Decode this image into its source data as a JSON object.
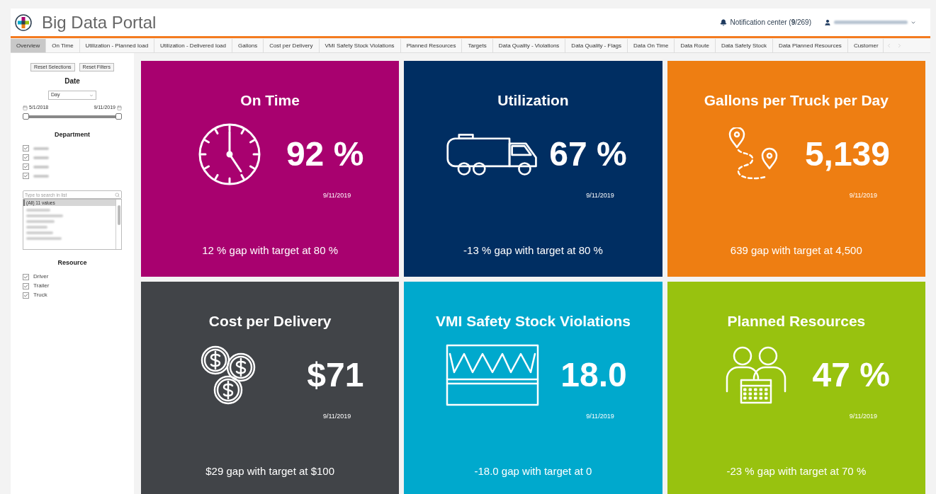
{
  "header": {
    "title": "Big Data Portal",
    "notification": "Notification center (**9**/269)"
  },
  "tabs": [
    {
      "label": "Overview",
      "selected": true
    },
    {
      "label": "On Time",
      "selected": false
    },
    {
      "label": "Utilization - Planned load",
      "selected": false
    },
    {
      "label": "Utilization - Delivered load",
      "selected": false
    },
    {
      "label": "Gallons",
      "selected": false
    },
    {
      "label": "Cost per Delivery",
      "selected": false
    },
    {
      "label": "VMI Safety Stock Violations",
      "selected": false
    },
    {
      "label": "Planned Resources",
      "selected": false
    },
    {
      "label": "Targets",
      "selected": false
    },
    {
      "label": "Data Quality - Violations",
      "selected": false
    },
    {
      "label": "Data Quality - Flags",
      "selected": false
    },
    {
      "label": "Data On Time",
      "selected": false
    },
    {
      "label": "Data Route",
      "selected": false
    },
    {
      "label": "Data Safety Stock",
      "selected": false
    },
    {
      "label": "Data Planned Resources",
      "selected": false
    },
    {
      "label": "Customer",
      "selected": false
    }
  ],
  "sidebar": {
    "buttons": [
      "Reset Selections",
      "Reset Filters"
    ],
    "date": {
      "heading": "Date",
      "granularity": "Day",
      "start": "5/1/2018",
      "end": "9/11/2019",
      "level": 1
    },
    "department": {
      "heading": "Department",
      "items": [
        {
          "checked": true
        },
        {
          "checked": true
        },
        {
          "checked": true
        },
        {
          "checked": true
        }
      ]
    },
    "list": {
      "placeholder": "Type to search in list",
      "first_item": "(All) 11 values"
    },
    "resource": {
      "heading": "Resource",
      "items": [
        {
          "label": "Driver",
          "checked": true
        },
        {
          "label": "Trailer",
          "checked": true
        },
        {
          "label": "Truck",
          "checked": true
        }
      ]
    }
  },
  "tiles": [
    {
      "kind": "clock",
      "title": "On Time",
      "value": "92 %",
      "date": "9/11/2019",
      "gap": "12 % gap with target at 80 %",
      "color": "#a8016f"
    },
    {
      "kind": "truck",
      "title": "Utilization",
      "value": "67 %",
      "date": "9/11/2019",
      "gap": "-13 % gap with target at 80 %",
      "color": "#002e62"
    },
    {
      "kind": "route",
      "title": "Gallons per Truck per Day",
      "value": "5,139",
      "date": "9/11/2019",
      "gap": "639 gap with target at 4,500",
      "color": "#ee7e12"
    },
    {
      "kind": "coins",
      "title": "Cost per Delivery",
      "value": "$71",
      "date": "9/11/2019",
      "gap": "$29 gap with target at $100",
      "color": "#414448"
    },
    {
      "kind": "stock",
      "title": "VMI Safety Stock Violations",
      "value": "18.0",
      "date": "9/11/2019",
      "gap": "-18.0 gap with target at 0",
      "color": "#00a9cd"
    },
    {
      "kind": "people",
      "title": "Planned Resources",
      "value": "47 %",
      "date": "9/11/2019",
      "gap": "-23 % gap with target at 70 %",
      "color": "#98c20f"
    }
  ]
}
